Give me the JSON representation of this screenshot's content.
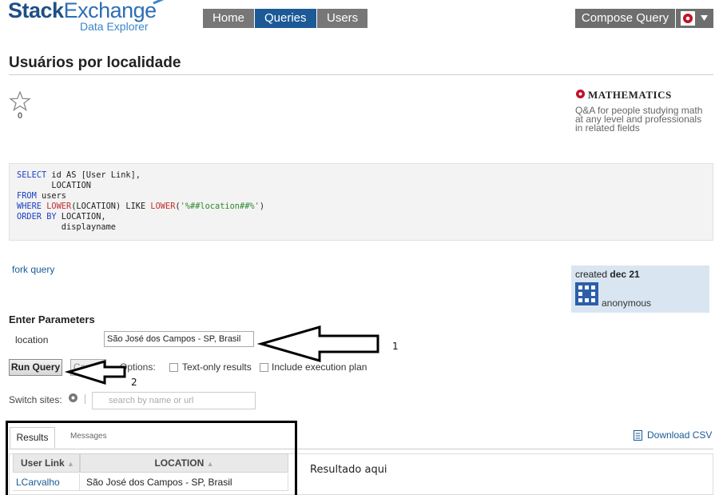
{
  "header": {
    "logo_main_bold": "Stack",
    "logo_main_thin": "Exchange",
    "logo_sub": "Data Explorer",
    "nav": [
      "Home",
      "Queries",
      "Users"
    ],
    "active_nav": "Queries",
    "compose_label": "Compose Query"
  },
  "query": {
    "title": "Usuários por localidade",
    "favorite_count": "0",
    "sql": {
      "l1_kw": "SELECT",
      "l1_rest": " id AS [User Link],",
      "l2": "       LOCATION",
      "l3_kw": "FROM",
      "l3_rest": " users",
      "l4_kw": "WHERE",
      "l4_fn1": "LOWER",
      "l4_mid": "(LOCATION) LIKE ",
      "l4_fn2": "LOWER",
      "l4_open": "(",
      "l4_str": "'%##location##%'",
      "l4_close": ")",
      "l5_kw": "ORDER BY",
      "l5_rest": " LOCATION,",
      "l6": "         displayname"
    },
    "fork_label": "fork query",
    "created_prefix": "created",
    "created_date": "dec 21",
    "author": "anonymous"
  },
  "site": {
    "name": "MATHEMATICS",
    "description": "Q&A for people studying math at any level and professionals in related fields"
  },
  "parameters": {
    "heading": "Enter Parameters",
    "location_label": "location",
    "location_value": "São José dos Campos - SP, Brasil"
  },
  "controls": {
    "run_label": "Run Query",
    "cancel_label": "Cancel",
    "options_label": "Options:",
    "text_only_label": "Text-only results",
    "exec_plan_label": "Include execution plan",
    "switch_sites_label": "Switch sites:",
    "site_search_placeholder": "search by name or url"
  },
  "results": {
    "tabs": [
      "Results",
      "Messages"
    ],
    "download_label": "Download CSV",
    "columns": [
      "User Link",
      "LOCATION"
    ],
    "rows": [
      {
        "user": "LCarvalho",
        "location": "São José dos Campos - SP, Brasil"
      }
    ],
    "note": "Resultado aqui"
  },
  "annotations": {
    "arrow1_label": "1",
    "arrow2_label": "2"
  },
  "colors": {
    "brand_blue": "#1b5a96",
    "nav_gray": "#777777",
    "annotation": "#000000"
  }
}
